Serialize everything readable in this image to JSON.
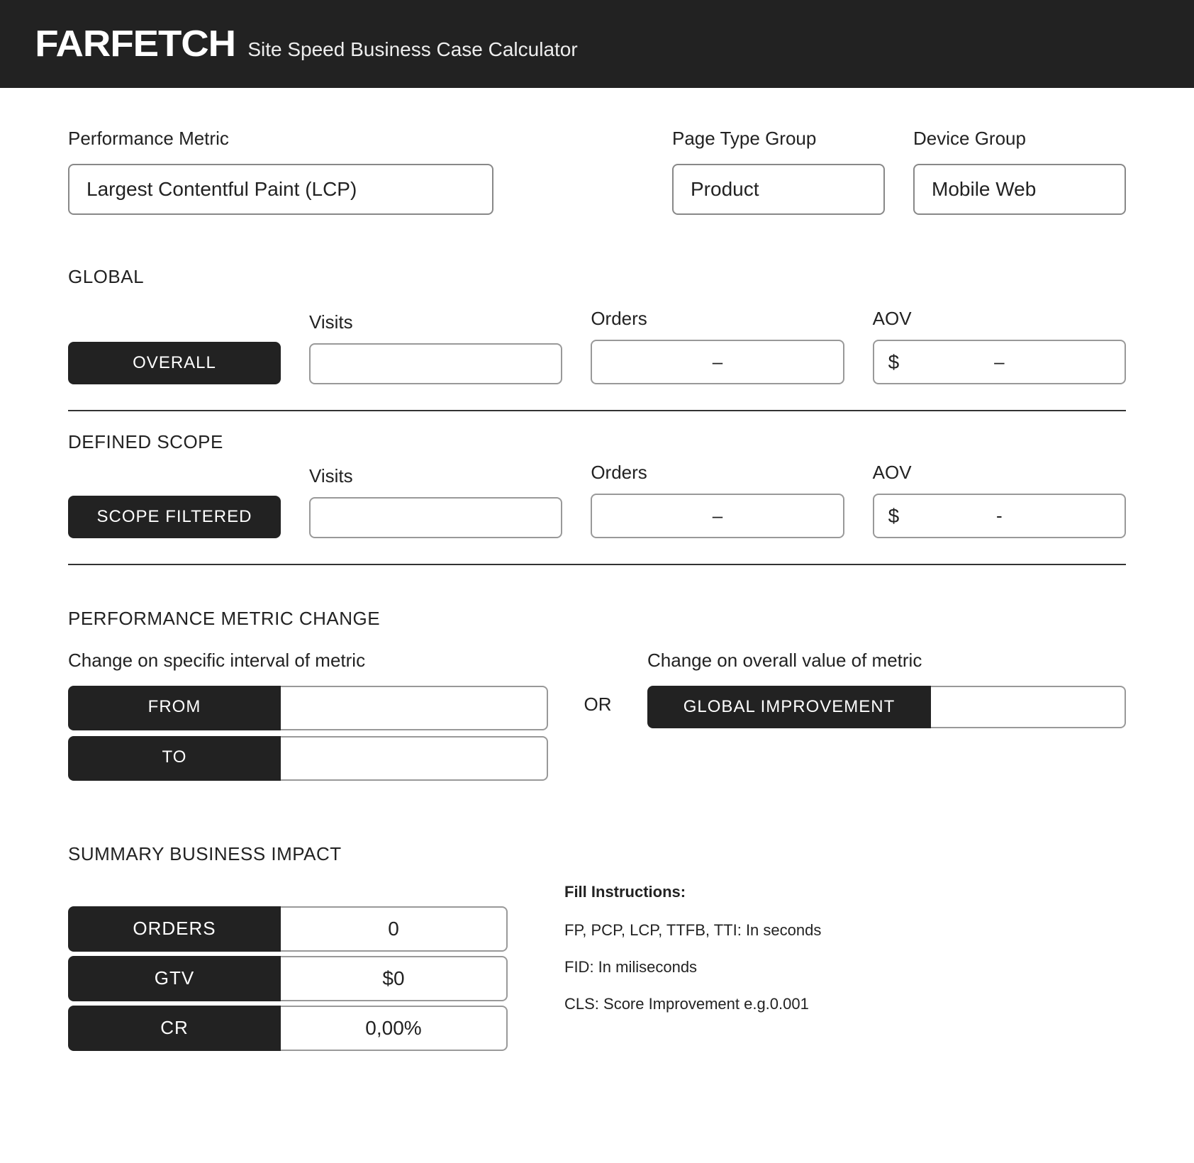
{
  "header": {
    "logo": "FARFETCH",
    "subtitle": "Site Speed Business Case Calculator"
  },
  "filters": {
    "metric": {
      "label": "Performance Metric",
      "value": "Largest Contentful Paint (LCP)"
    },
    "page_type": {
      "label": "Page Type Group",
      "value": "Product"
    },
    "device": {
      "label": "Device Group",
      "value": "Mobile Web"
    }
  },
  "global": {
    "heading": "GLOBAL",
    "badge": "OVERALL",
    "cols": {
      "visits": "Visits",
      "orders": "Orders",
      "aov": "AOV"
    },
    "values": {
      "visits": "",
      "orders": "–",
      "aov_currency": "$",
      "aov_value": "–"
    }
  },
  "scope": {
    "heading": "DEFINED SCOPE",
    "badge": "SCOPE FILTERED",
    "cols": {
      "visits": "Visits",
      "orders": "Orders",
      "aov": "AOV"
    },
    "values": {
      "visits": "",
      "orders": "–",
      "aov_currency": "$",
      "aov_value": "-"
    }
  },
  "change": {
    "heading": "PERFORMANCE METRIC CHANGE",
    "interval_label": "Change on specific interval of metric",
    "from_label": "FROM",
    "to_label": "TO",
    "from_value": "",
    "to_value": "",
    "or": "OR",
    "overall_label": "Change on overall value of metric",
    "global_improve_label": "GLOBAL IMPROVEMENT",
    "global_improve_value": ""
  },
  "summary": {
    "heading": "SUMMARY BUSINESS IMPACT",
    "rows": {
      "orders": {
        "label": "ORDERS",
        "value": "0"
      },
      "gtv": {
        "label": "GTV",
        "value": "$0"
      },
      "cr": {
        "label": "CR",
        "value": "0,00%"
      }
    }
  },
  "instructions": {
    "heading": "Fill Instructions:",
    "line1": "FP, PCP, LCP, TTFB, TTI: In seconds",
    "line2": "FID: In miliseconds",
    "line3": "CLS: Score Improvement e.g.0.001"
  }
}
